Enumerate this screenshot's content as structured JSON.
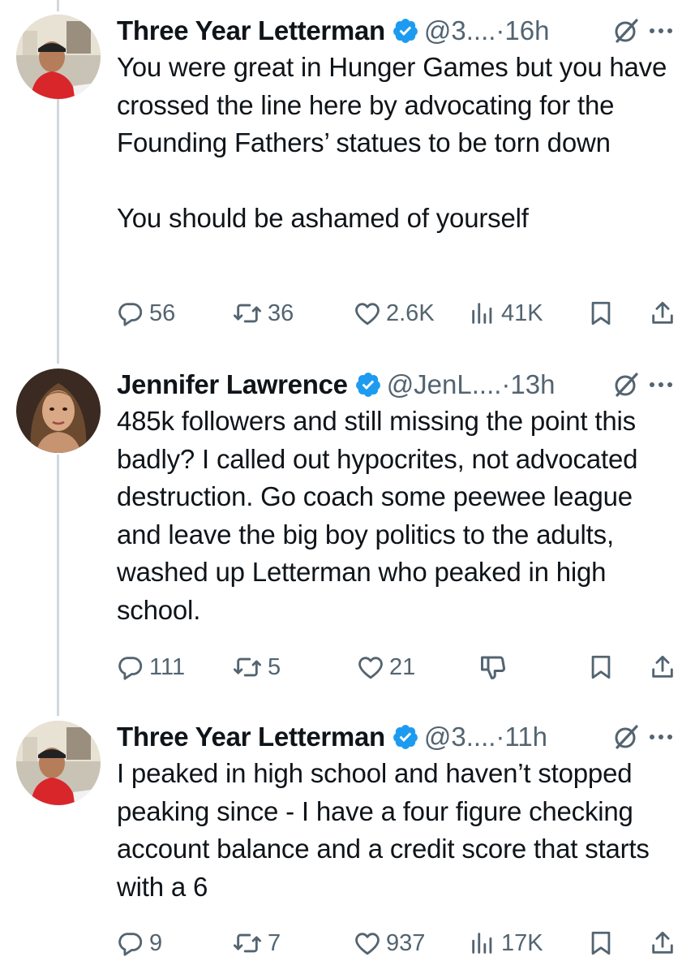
{
  "thread": [
    {
      "author_name": "Three Year Letterman",
      "handle": "@3....",
      "dot": "·",
      "time": "16h",
      "avatar_desc": "man-in-red-shirt-avatar",
      "text": "You were great in Hunger Games but you have crossed the line here by advocating for the Founding Fathers’ statues to be torn down\n\nYou should be ashamed of yourself",
      "stats": {
        "replies": "56",
        "reposts": "36",
        "likes": "2.6K",
        "views": "41K"
      }
    },
    {
      "author_name": "Jennifer Lawrence",
      "handle": "@JenL....",
      "dot": "·",
      "time": "13h",
      "avatar_desc": "woman-portrait-avatar",
      "text": "485k followers and still missing the point this badly? I called out hypocrites, not advocated destruction. Go coach some peewee league and leave the big boy politics to the adults, washed up Letterman who peaked in high school.",
      "stats": {
        "replies": "111",
        "reposts": "5",
        "likes": "21"
      }
    },
    {
      "author_name": "Three Year Letterman",
      "handle": "@3....",
      "dot": "·",
      "time": "11h",
      "avatar_desc": "man-in-red-shirt-avatar",
      "text": "I peaked in high school and haven’t stopped peaking since - I have a four figure checking account balance and a credit score that starts with a 6",
      "stats": {
        "replies": "9",
        "reposts": "7",
        "likes": "937",
        "views": "17K"
      }
    }
  ],
  "colors": {
    "text": "#0f1419",
    "secondary": "#536471",
    "verified": "#1d9bf0",
    "thread_line": "#cfd9de"
  }
}
